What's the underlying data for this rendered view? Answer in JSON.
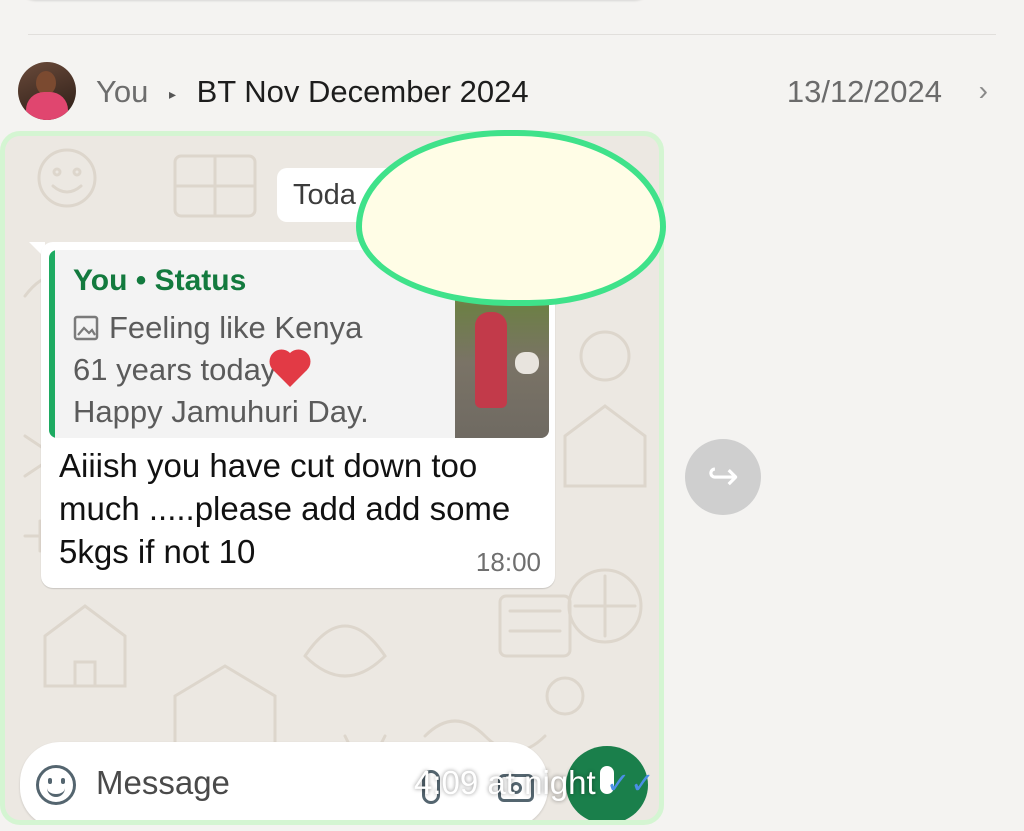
{
  "header": {
    "author": "You",
    "chat_name": "BT Nov December 2024",
    "date": "13/12/2024",
    "separator": "▸",
    "chevron": "›"
  },
  "conversation": {
    "date_pill": "Toda",
    "reply": {
      "title": "You • Status",
      "line1": "Feeling like Kenya",
      "line2": "61 years today",
      "line3": "Happy Jamuhuri Day.",
      "image_icon": "image-icon",
      "heart_icon": "heart-icon"
    },
    "message": {
      "text": "Aiiish you have cut down too much .....please add add some 5kgs if not 10",
      "time": "18:00"
    }
  },
  "composer": {
    "placeholder": "Message",
    "overlay_caption": "4:09 at night",
    "ticks": "✓✓"
  },
  "icons": {
    "forward": "forward-icon",
    "emoji": "emoji-icon",
    "attach": "attach-icon",
    "camera": "camera-icon",
    "mic": "mic-icon"
  },
  "colors": {
    "accent_green": "#1daa61",
    "panel_border": "#d4f5d2",
    "overlay_border": "#3fe28a",
    "overlay_fill": "#fffde6",
    "tick_blue": "#4a8fe6"
  }
}
